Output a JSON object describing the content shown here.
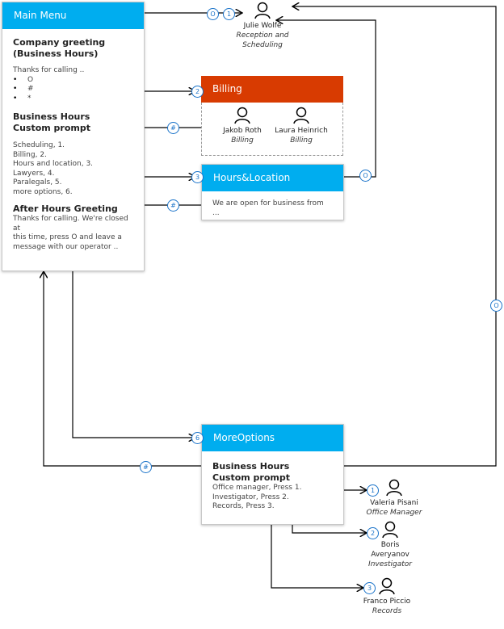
{
  "main_menu": {
    "title": "Main Menu",
    "greeting_heading": [
      "Company greeting",
      "(Business Hours)"
    ],
    "greeting_text": "Thanks for calling ..",
    "greeting_bullets": [
      "O",
      "#",
      "*"
    ],
    "custom_heading": [
      "Business Hours",
      "Custom prompt"
    ],
    "custom_lines": [
      "Scheduling,  1.",
      "Billing,  2.",
      "Hours and location, 3.",
      "Lawyers, 4.",
      "Paralegals, 5.",
      "more options, 6."
    ],
    "after_heading": "After Hours Greeting",
    "after_lines": [
      "Thanks for calling. We're closed at",
      "this time, press O and leave a",
      "message with our operator .."
    ]
  },
  "reception": {
    "name": "Julie Wolfe",
    "role": [
      "Reception and",
      "Scheduling"
    ],
    "badges": [
      "O",
      "1"
    ]
  },
  "billing": {
    "title": "Billing",
    "badge": "2",
    "header_color": "#d83b01",
    "people": [
      {
        "name": "Jakob Roth",
        "role": "Billing"
      },
      {
        "name": "Laura Heinrich",
        "role": "Billing"
      }
    ]
  },
  "hours": {
    "title": "Hours&Location",
    "badge": "3",
    "text": "We are open for business from ...",
    "return_badge": "O"
  },
  "more": {
    "title": "MoreOptions",
    "badge": "6",
    "heading": [
      "Business Hours",
      "Custom prompt"
    ],
    "lines": [
      "Office manager, Press 1.",
      "Investigator, Press 2.",
      "Records, Press 3."
    ],
    "return_badge": "O",
    "back_badge": "#",
    "people": [
      {
        "badge": "1",
        "name": "Valeria Pisani",
        "role": "Office Manager"
      },
      {
        "badge": "2",
        "name": "Boris",
        "name2": "Averyanov",
        "role": "Investigator"
      },
      {
        "badge": "3",
        "name": "Franco Piccio",
        "role": "Records"
      }
    ]
  },
  "hash_badges": [
    "#",
    "#"
  ],
  "colors": {
    "accent": "#00adef",
    "billing": "#d83b01",
    "badge": "#1a73c9"
  }
}
